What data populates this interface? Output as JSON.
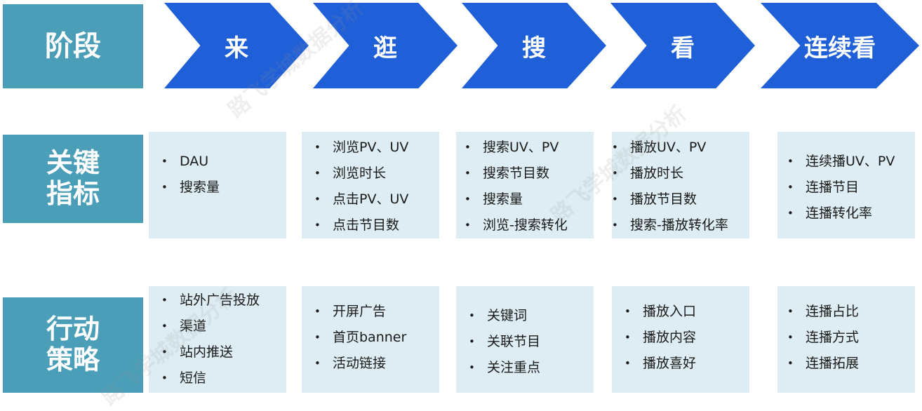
{
  "row_labels": {
    "stage": [
      "阶段"
    ],
    "metrics": [
      "关键",
      "指标"
    ],
    "actions": [
      "行动",
      "策略"
    ]
  },
  "stages": [
    "来",
    "逛",
    "搜",
    "看",
    "连续看"
  ],
  "metrics": [
    [
      "DAU",
      "搜索量"
    ],
    [
      "浏览PV、UV",
      "浏览时长",
      "点击PV、UV",
      "点击节目数"
    ],
    [
      "搜索UV、PV",
      "搜索节目数",
      "搜索量",
      "浏览-搜索转化"
    ],
    [
      "播放UV、PV",
      "播放时长",
      "播放节目数",
      "搜索-播放转化率"
    ],
    [
      "连续播UV、PV",
      "连播节目",
      "连播转化率"
    ]
  ],
  "actions": [
    [
      "站外广告投放",
      "渠道",
      "站内推送",
      "短信"
    ],
    [
      "开屏广告",
      "首页banner",
      "活动链接"
    ],
    [
      "关键词",
      "关联节目",
      "关注重点"
    ],
    [
      "播放入口",
      "播放内容",
      "播放喜好"
    ],
    [
      "连播占比",
      "连播方式",
      "连播拓展"
    ]
  ],
  "watermark": "路飞学城数据分析",
  "colors": {
    "label_bg": "#4a9eb8",
    "chevron_bg": "#1f5fd8",
    "panel_bg": "#deedf3",
    "text": "#1a1a1a"
  }
}
